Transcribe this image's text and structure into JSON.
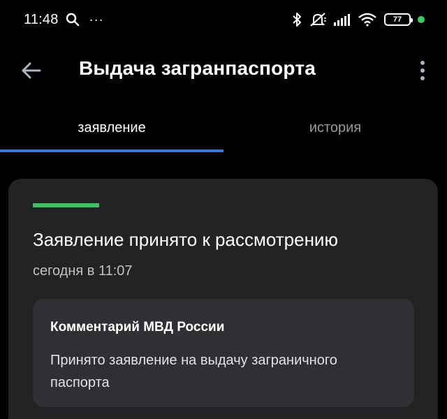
{
  "status_bar": {
    "time": "11:48",
    "more_indicator": "···",
    "battery_level": "77",
    "icons": [
      "search-icon",
      "bluetooth-icon",
      "mute-vibrate-icon",
      "signal-icon",
      "wifi-icon",
      "battery-icon"
    ]
  },
  "app_bar": {
    "title": "Выдача загранпаспорта",
    "back_icon": "arrow-left-icon",
    "menu_icon": "more-vertical-icon"
  },
  "tabs": [
    {
      "label": "заявление",
      "active": true
    },
    {
      "label": "история",
      "active": false
    }
  ],
  "card": {
    "status_color": "#35c85a",
    "title": "Заявление принято к рассмотрению",
    "time": "сегодня в 11:07",
    "comment": {
      "author": "Комментарий МВД России",
      "text": "Принято заявление на выдачу заграничного паспорта"
    }
  },
  "colors": {
    "background": "#000000",
    "accent": "#3a78e0",
    "card": "#232326",
    "comment_box": "#303034",
    "status_green": "#35c85a"
  }
}
